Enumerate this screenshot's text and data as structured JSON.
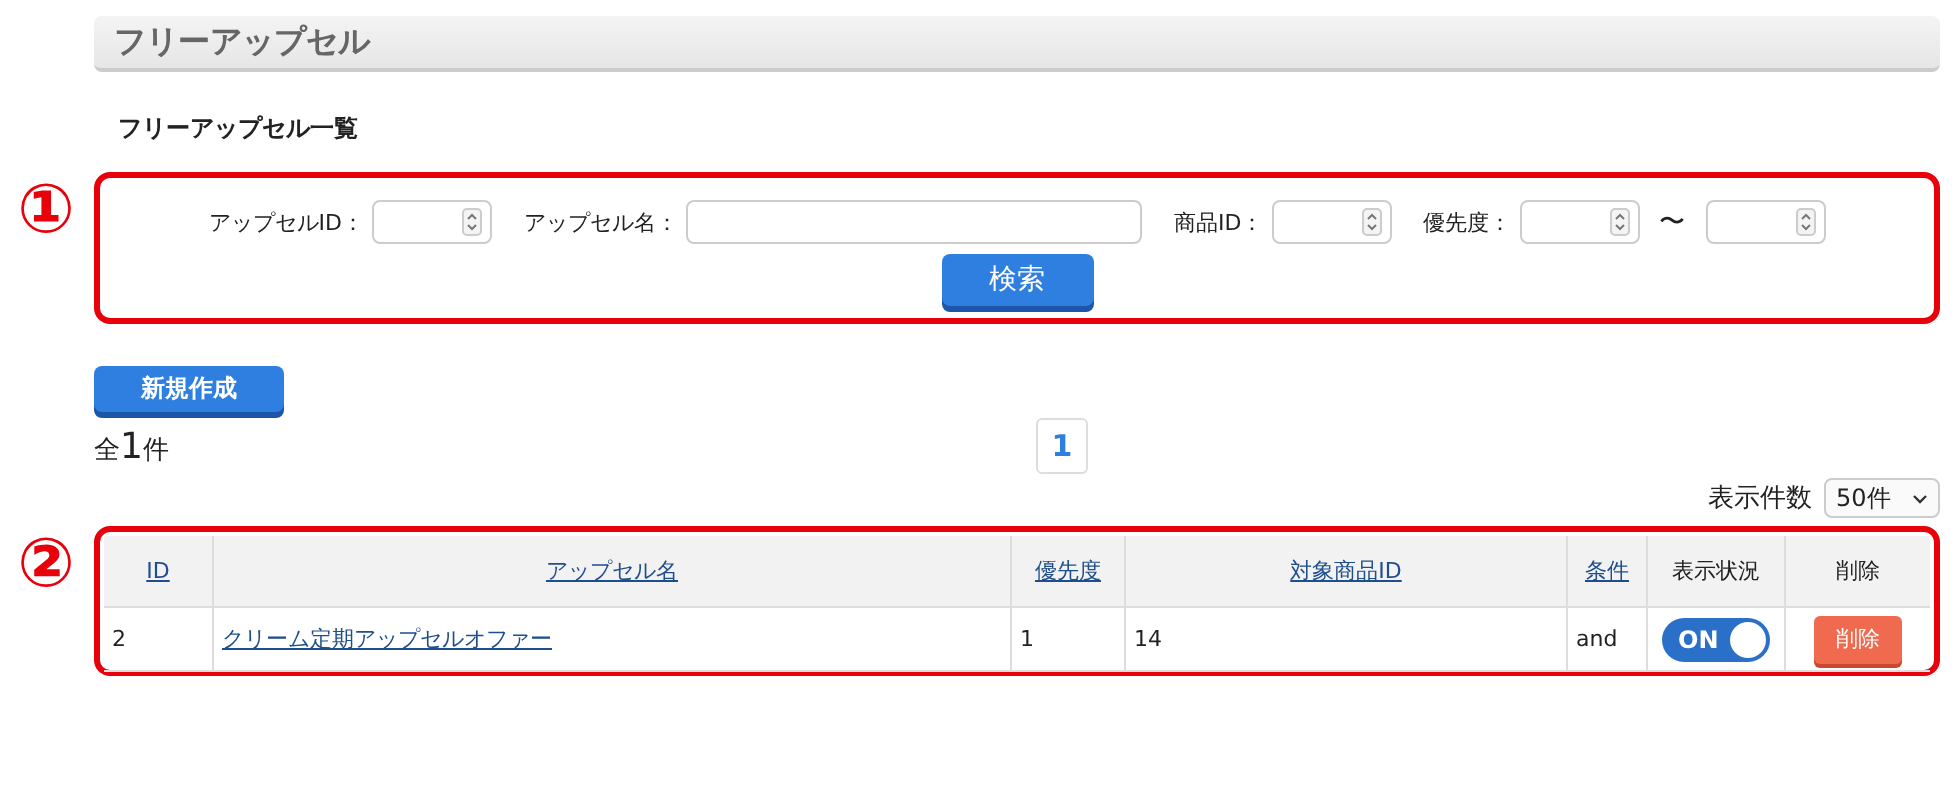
{
  "page_title": "フリーアップセル",
  "section_title": "フリーアップセル一覧",
  "markers": [
    "①",
    "②"
  ],
  "search": {
    "fields": [
      {
        "label": "アップセルID：",
        "kind": "number"
      },
      {
        "label": "アップセル名：",
        "kind": "text"
      },
      {
        "label": "商品ID：",
        "kind": "number"
      },
      {
        "label": "優先度：",
        "kind": "range",
        "separator": "〜"
      }
    ],
    "button": "検索"
  },
  "new_button": "新規作成",
  "total": {
    "prefix": "全",
    "count": "1",
    "suffix": "件"
  },
  "pages": [
    {
      "label": "1",
      "selected": true
    }
  ],
  "per_page": {
    "label": "表示件数",
    "value": "50件"
  },
  "table": {
    "columns": [
      {
        "label": "ID",
        "sortable": true
      },
      {
        "label": "アップセル名",
        "sortable": true
      },
      {
        "label": "優先度",
        "sortable": true
      },
      {
        "label": "対象商品ID",
        "sortable": true
      },
      {
        "label": "条件",
        "sortable": true
      },
      {
        "label": "表示状況",
        "sortable": false
      },
      {
        "label": "削除",
        "sortable": false
      }
    ],
    "rows": [
      {
        "id": "2",
        "name": "クリーム定期アップセルオファー",
        "priority": "1",
        "product_ids": "14",
        "condition": "and",
        "display": {
          "label": "ON",
          "on": true
        },
        "delete": "削除"
      }
    ]
  }
}
